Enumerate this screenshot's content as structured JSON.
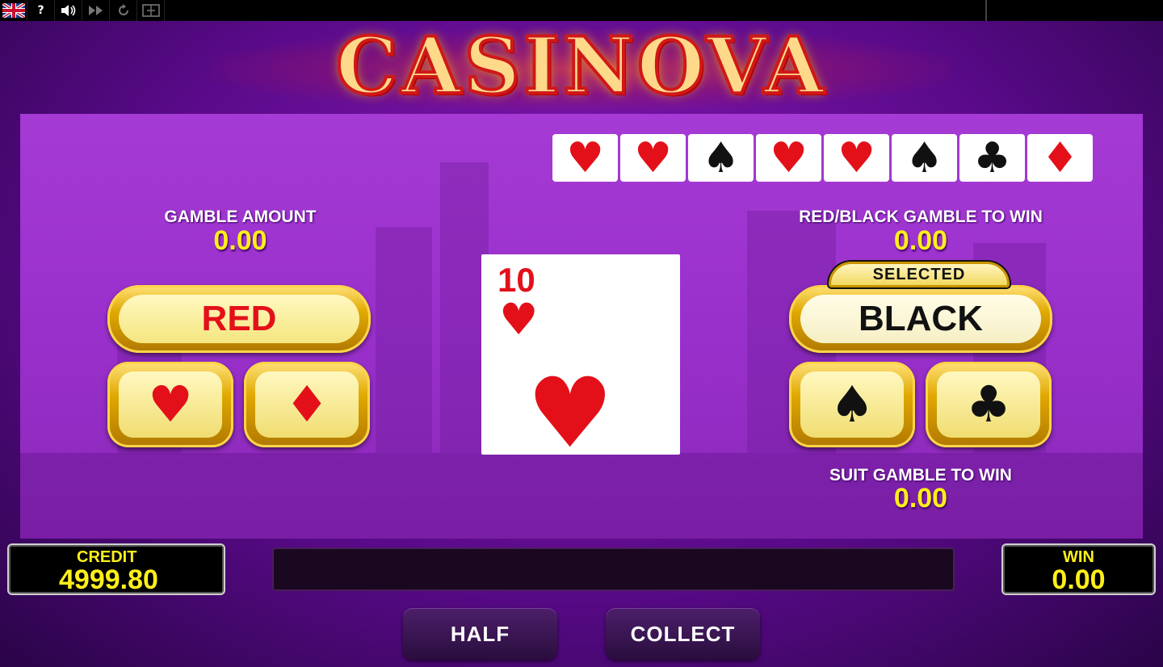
{
  "toolbar": {
    "flag_icon": "uk-flag-icon",
    "help_label": "?",
    "sound_icon": "speaker-icon",
    "fast_forward_icon": "fast-forward-icon",
    "replay_icon": "replay-icon",
    "fullscreen_icon": "fullscreen-icon"
  },
  "logo": "CASINOVA",
  "history": [
    {
      "suit": "♥",
      "color": "red"
    },
    {
      "suit": "♥",
      "color": "red"
    },
    {
      "suit": "♠",
      "color": "black"
    },
    {
      "suit": "♥",
      "color": "red"
    },
    {
      "suit": "♥",
      "color": "red"
    },
    {
      "suit": "♠",
      "color": "black"
    },
    {
      "suit": "♣",
      "color": "black"
    },
    {
      "suit": "♦",
      "color": "red"
    }
  ],
  "gamble_amount": {
    "label": "GAMBLE AMOUNT",
    "value": "0.00"
  },
  "red_black_win": {
    "label": "RED/BLACK GAMBLE TO WIN",
    "value": "0.00"
  },
  "suit_win": {
    "label": "SUIT GAMBLE TO WIN",
    "value": "0.00"
  },
  "buttons": {
    "red": "RED",
    "black": "BLACK",
    "selected_badge": "SELECTED",
    "hearts": "♥",
    "diamonds": "♦",
    "spades": "♠",
    "clubs": "♣",
    "half": "HALF",
    "collect": "COLLECT"
  },
  "current_card": {
    "rank": "10",
    "suit": "♥",
    "color": "red"
  },
  "credit": {
    "label": "CREDIT",
    "value": "4999.80"
  },
  "win": {
    "label": "WIN",
    "value": "0.00"
  },
  "message": "",
  "colors": {
    "red_suit": "#e3101a",
    "yellow_value": "#ffef1a",
    "panel": "#9a30cc"
  }
}
